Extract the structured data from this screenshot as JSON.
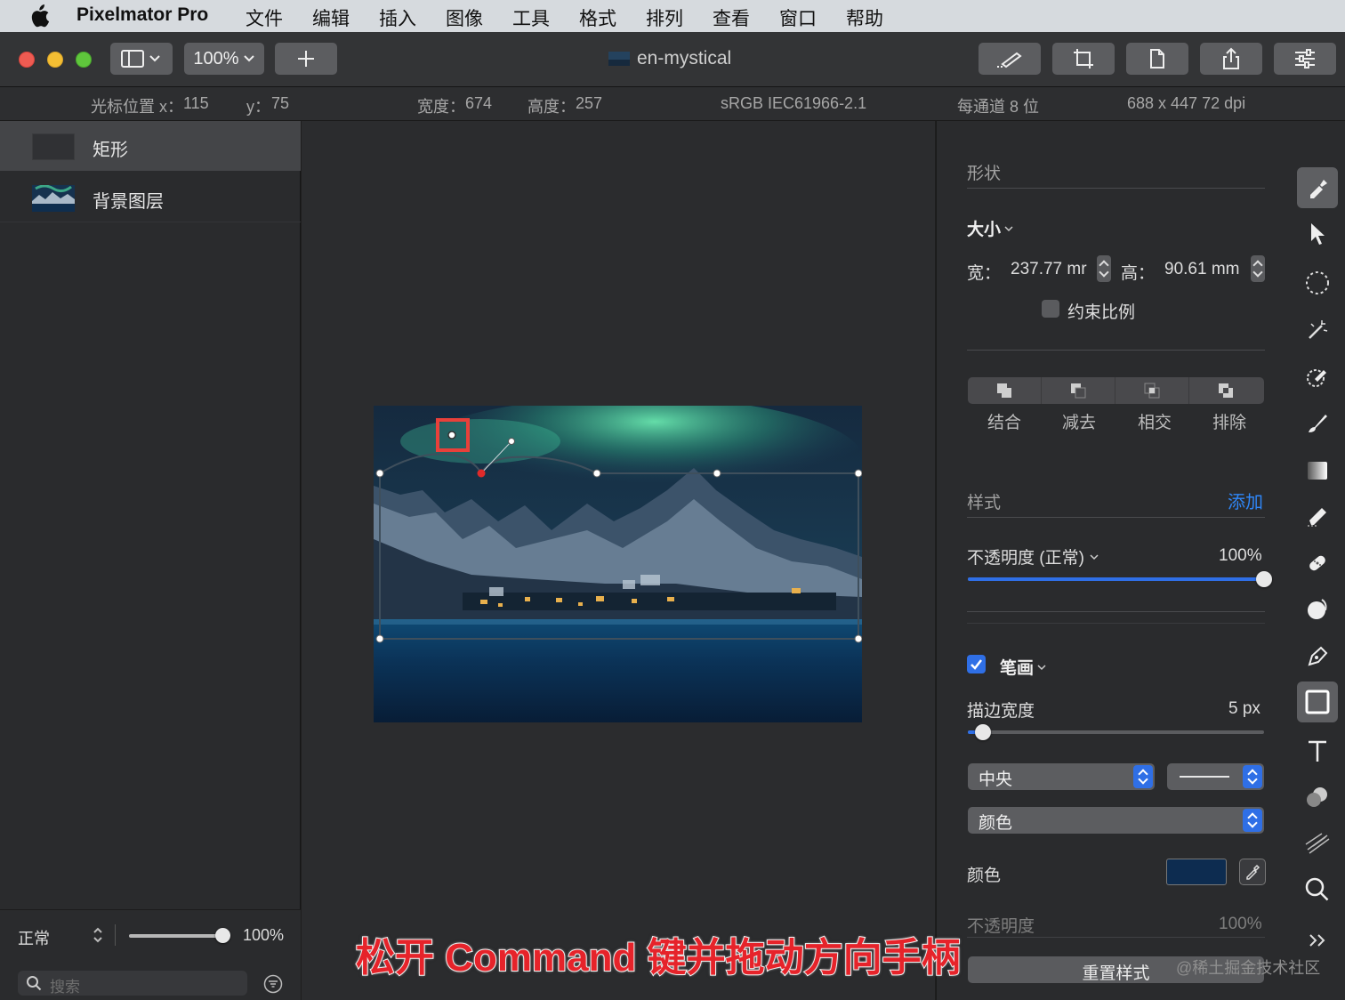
{
  "menubar": {
    "app_name": "Pixelmator Pro",
    "items": [
      "文件",
      "编辑",
      "插入",
      "图像",
      "工具",
      "格式",
      "排列",
      "查看",
      "窗口",
      "帮助"
    ]
  },
  "toolbar": {
    "zoom": "100%",
    "document_title": "en-mystical"
  },
  "infobar": {
    "cursor_x_label": "光标位置 x：",
    "cursor_x": "115",
    "cursor_y_label": "y：",
    "cursor_y": "75",
    "width_label": "宽度：",
    "width": "674",
    "height_label": "高度：",
    "height": "257",
    "color_profile": "sRGB IEC61966-2.1",
    "bit_depth": "每通道 8 位",
    "image_size": "688 x 447 72 dpi"
  },
  "layers": {
    "items": [
      {
        "name": "矩形",
        "selected": true
      },
      {
        "name": "背景图层",
        "selected": false
      }
    ],
    "blend_mode": "正常",
    "opacity": "100%",
    "opacity_fraction": 1.0,
    "search_placeholder": "搜索"
  },
  "sidebar": {
    "shape_section": "形状",
    "size_label": "大小",
    "width_label": "宽：",
    "width_value": "237.77 mr",
    "height_label": "高：",
    "height_value": "90.61 mm",
    "constrain_label": "约束比例",
    "constrain_checked": false,
    "boolean_ops": [
      "结合",
      "减去",
      "相交",
      "排除"
    ],
    "style_section": "样式",
    "style_add": "添加",
    "opacity_label": "不透明度 (正常)",
    "opacity_value": "100%",
    "opacity_fraction": 1.0,
    "stroke_label": "笔画",
    "stroke_checked": true,
    "stroke_width_label": "描边宽度",
    "stroke_width_value": "5 px",
    "stroke_width_fraction": 0.05,
    "stroke_position": "中央",
    "fill_type": "颜色",
    "color_label": "颜色",
    "stroke_color": "#0d2c50",
    "stroke_opacity_label": "不透明度",
    "stroke_opacity_value": "100%",
    "reset_button": "重置样式"
  },
  "tools": [
    "style-icon",
    "arrange-icon",
    "selection-icon",
    "magic-wand-icon",
    "repair-icon",
    "paint-icon",
    "gradient-icon",
    "erase-icon",
    "retouch-icon",
    "distort-icon",
    "pen-icon",
    "shape-icon",
    "type-icon",
    "color-adjust-icon",
    "effects-icon",
    "zoom-icon",
    "more-icon"
  ],
  "colors": {
    "accent": "#2f6fe6",
    "selection_handle": "#e02a2a",
    "highlight_box": "#e8403a"
  },
  "overlay": {
    "caption": "松开 Command 键并拖动方向手柄",
    "watermark": "@稀土掘金技术社区"
  }
}
